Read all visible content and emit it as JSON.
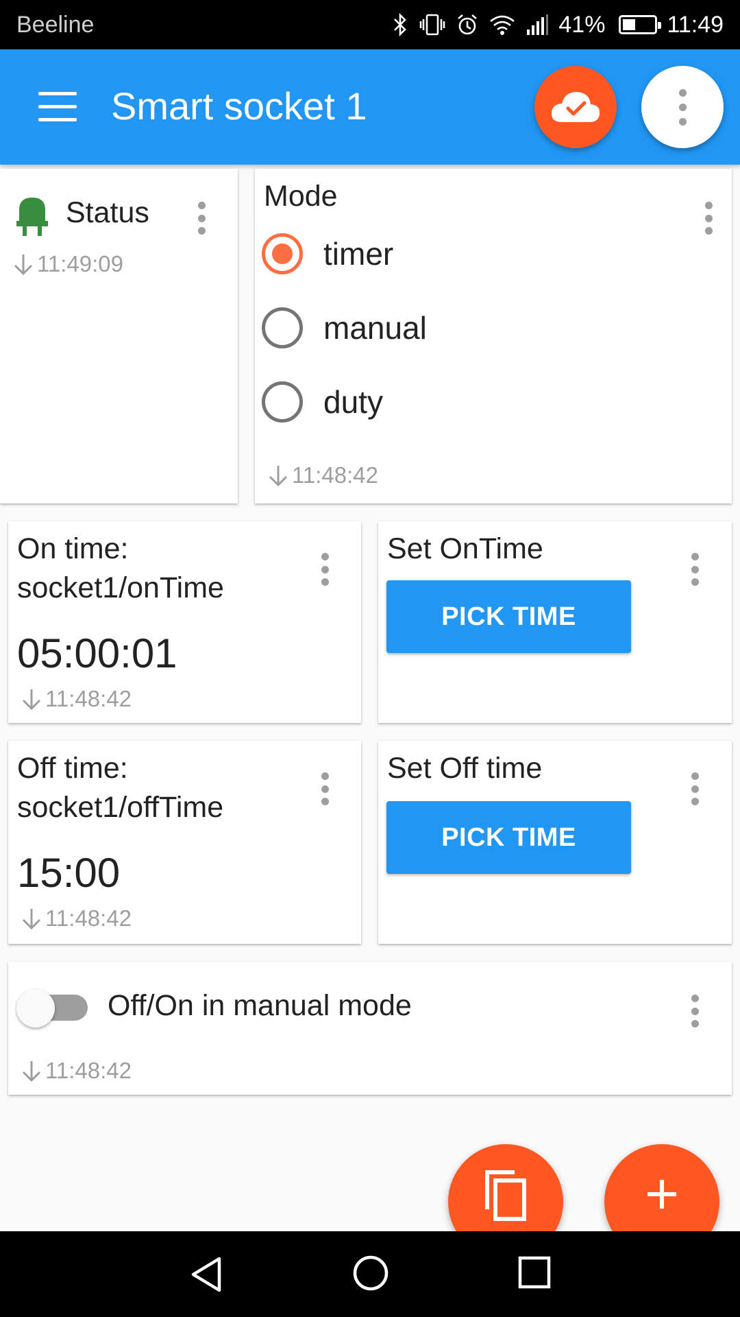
{
  "status_bar": {
    "carrier": "Beeline",
    "battery_percent": "41%",
    "battery_level": 0.41,
    "time": "11:49"
  },
  "app_bar": {
    "title": "Smart socket 1",
    "menu_icon": "hamburger-menu-icon",
    "cloud_icon": "cloud-check-icon",
    "overflow_icon": "more-vert-icon"
  },
  "widgets": {
    "status": {
      "label": "Status",
      "icon": "plug-icon",
      "icon_color": "#388e3c",
      "timestamp": "11:49:09"
    },
    "mode": {
      "title": "Mode",
      "options": [
        {
          "label": "timer",
          "checked": true
        },
        {
          "label": "manual",
          "checked": false
        },
        {
          "label": "duty",
          "checked": false
        }
      ],
      "timestamp": "11:48:42"
    },
    "on_time": {
      "title": "On time: socket1/onTime",
      "value": "05:00:01",
      "timestamp": "11:48:42"
    },
    "set_on_time": {
      "title": "Set OnTime",
      "button_label": "PICK TIME"
    },
    "off_time": {
      "title": "Off time: socket1/offTime",
      "value": "15:00",
      "timestamp": "11:48:42"
    },
    "set_off_time": {
      "title": "Set Off time",
      "button_label": "PICK TIME"
    },
    "manual_switch": {
      "label": "Off/On in manual mode",
      "checked": false,
      "timestamp": "11:48:42"
    }
  },
  "fabs": {
    "copy_icon": "copy-icon",
    "add_icon": "plus-icon"
  },
  "colors": {
    "primary": "#2196f3",
    "accent": "#ff5722",
    "radio_accent": "#ff6e40"
  }
}
